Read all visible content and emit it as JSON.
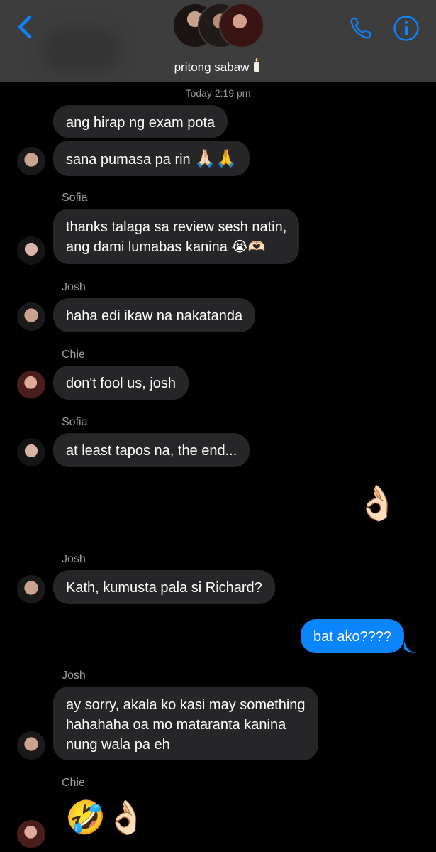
{
  "header": {
    "group_name": "pritong sabaw",
    "back_icon": "chevron-left-icon",
    "call_icon": "phone-icon",
    "info_icon": "info-icon",
    "accent": "#0a84ff"
  },
  "timestamp": "Today 2:19 pm",
  "messages": [
    {
      "sender": "",
      "text": "ang hirap ng exam pota"
    },
    {
      "sender": "",
      "text": "sana pumasa pa rin"
    },
    {
      "sender": "Sofia",
      "text": "thanks talaga sa review sesh natin,",
      "text2": "ang dami lumabas kanina"
    },
    {
      "sender": "Josh",
      "text": "haha edi ikaw na nakatanda"
    },
    {
      "sender": "Chie",
      "text": "don't fool us, josh"
    },
    {
      "sender": "Sofia",
      "text": "at least tapos na, the end..."
    },
    {
      "sender": "Josh",
      "text": "Kath, kumusta pala si Richard?"
    },
    {
      "sender": "me",
      "text": "bat ako????"
    },
    {
      "sender": "Josh",
      "text": "ay sorry, akala ko kasi may something",
      "text2": "hahahaha oa mo mataranta kanina",
      "text3": "nung wala pa eh"
    },
    {
      "sender": "Chie",
      "text": ""
    }
  ],
  "labels": {
    "sofia_1": "Sofia",
    "josh_1": "Josh",
    "chie_1": "Chie",
    "sofia_2": "Sofia",
    "josh_2": "Josh",
    "josh_3": "Josh",
    "chie_2": "Chie"
  },
  "colors": {
    "bubble_other": "#262628",
    "bubble_mine": "#0a84ff",
    "background": "#000000"
  }
}
